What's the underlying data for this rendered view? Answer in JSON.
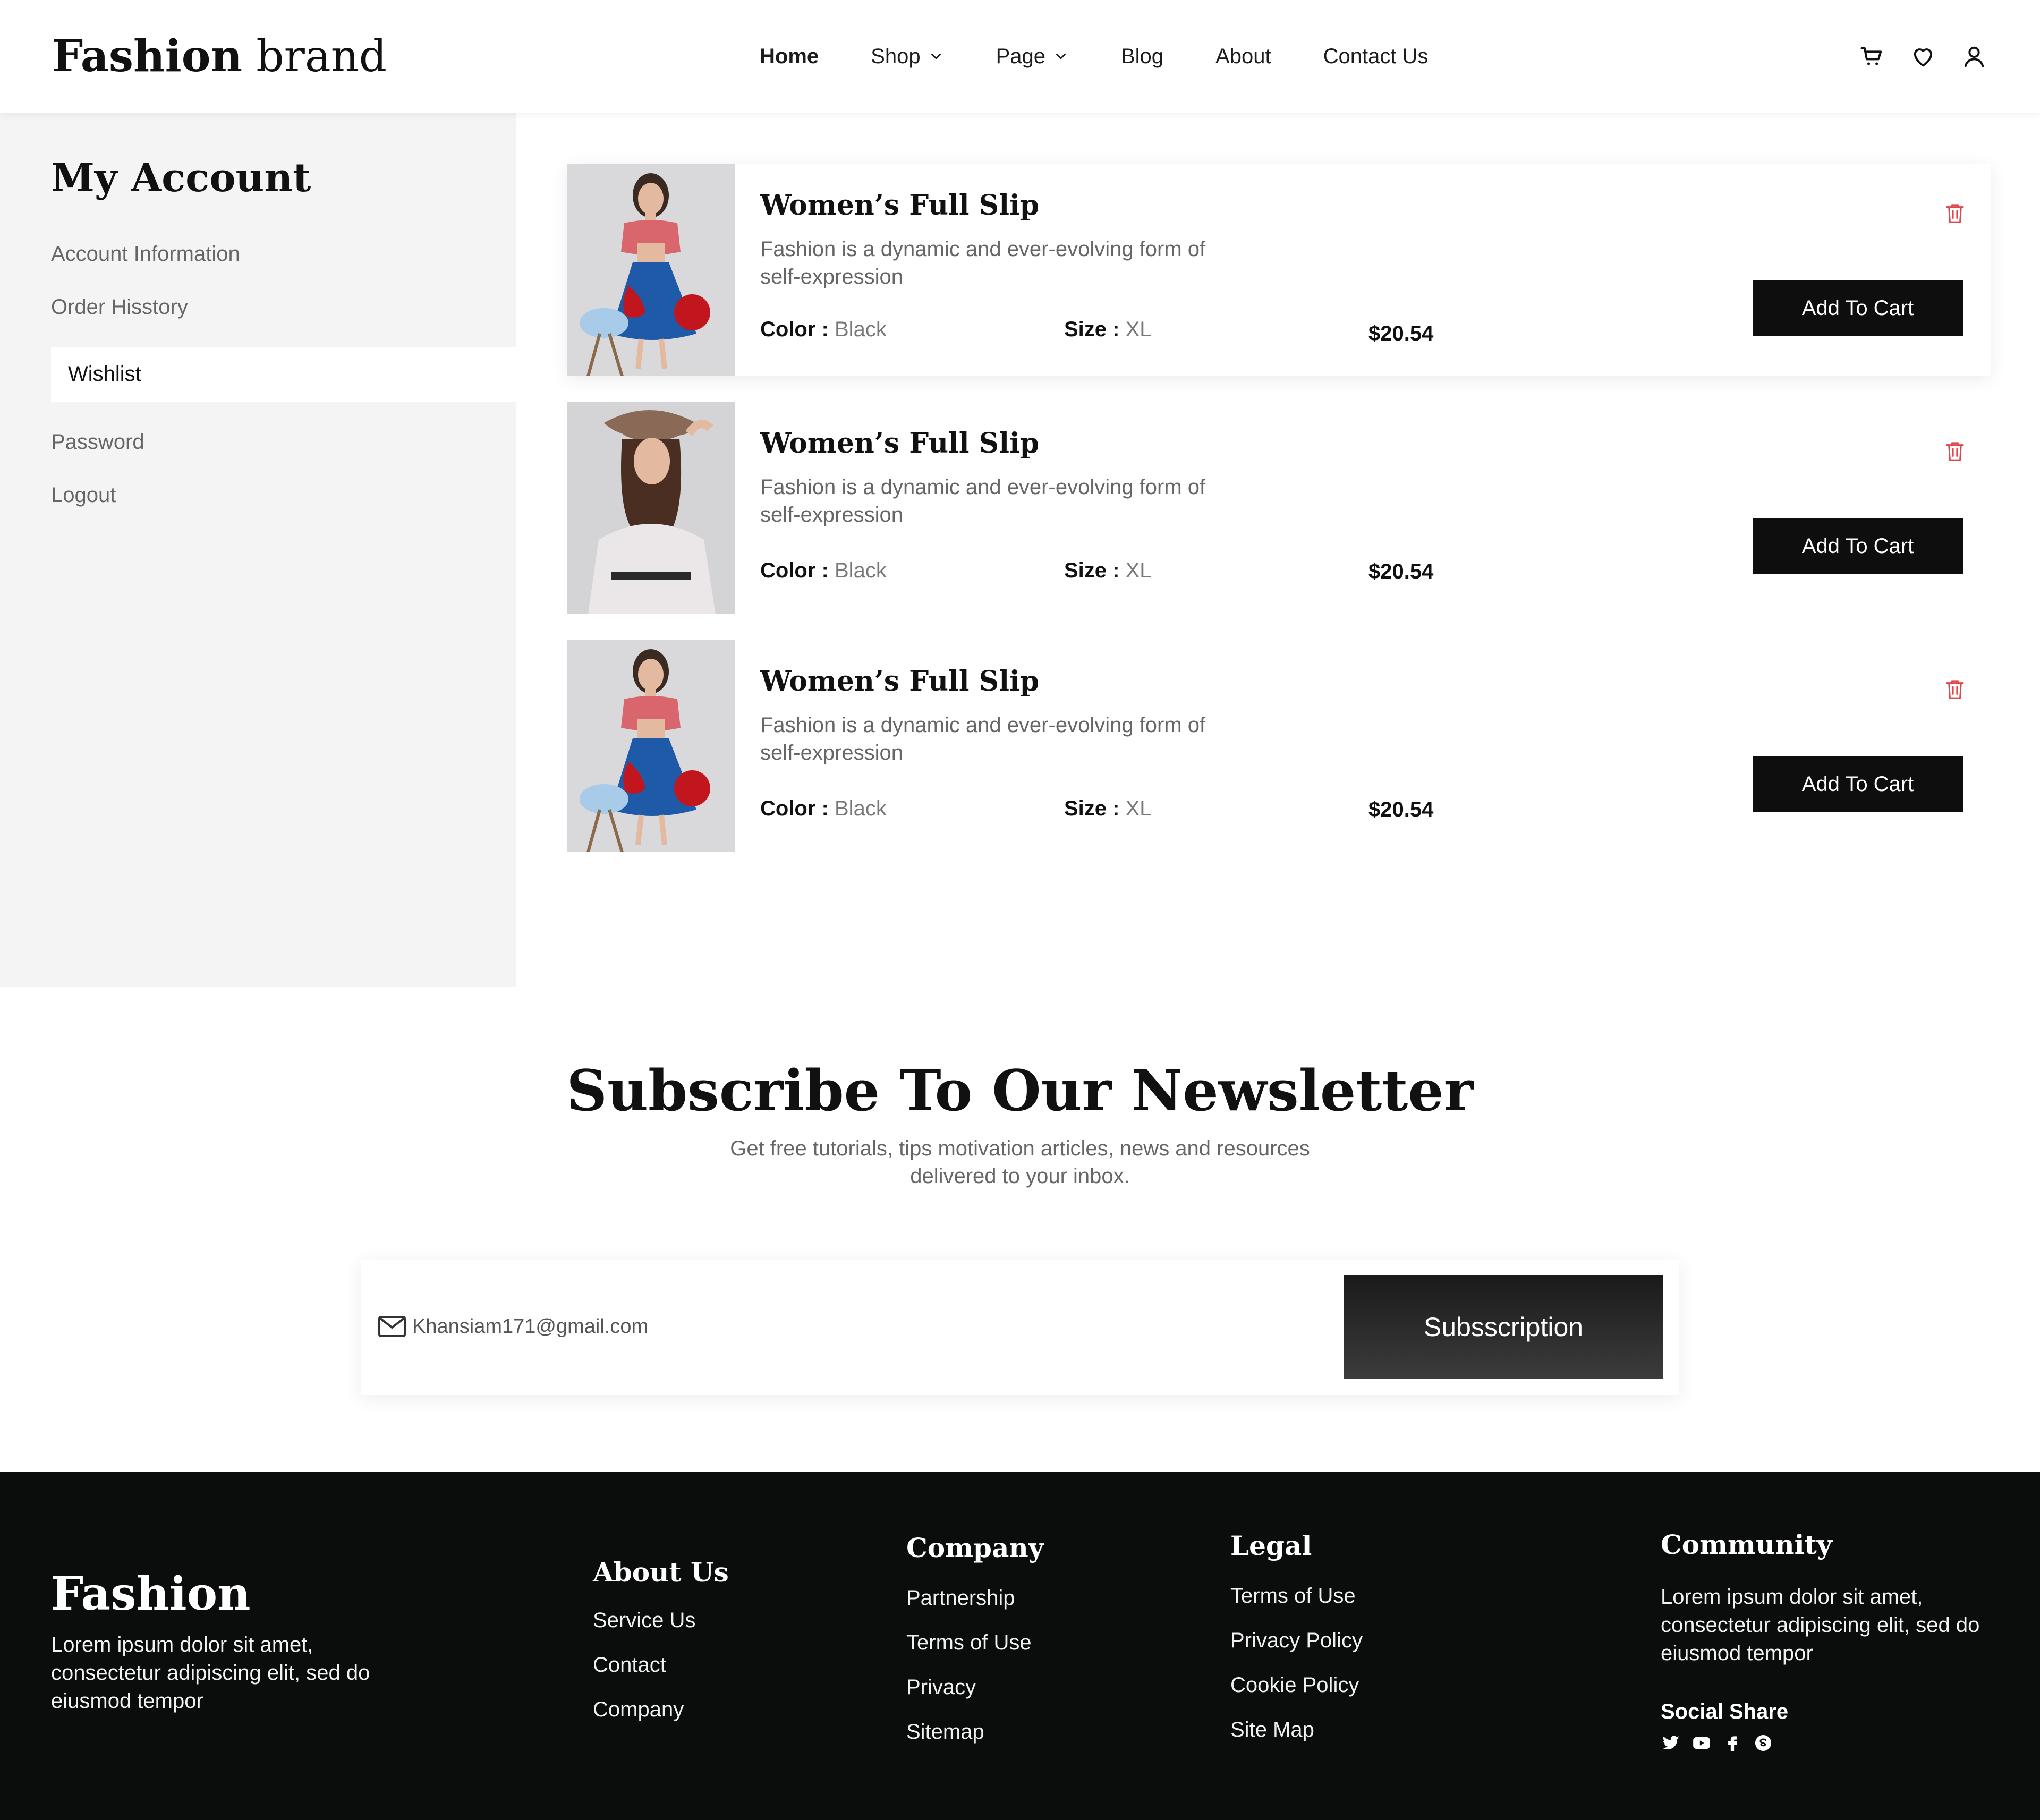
{
  "header": {
    "logo_bold": "Fashion",
    "logo_light": "brand",
    "nav": [
      {
        "label": "Home"
      },
      {
        "label": "Shop"
      },
      {
        "label": "Page"
      },
      {
        "label": "Blog"
      },
      {
        "label": "About"
      },
      {
        "label": "Contact Us"
      }
    ],
    "icons": [
      "cart-icon",
      "heart-icon",
      "user-icon"
    ]
  },
  "sidebar": {
    "title": "My Account",
    "items": [
      {
        "label": "Account Information"
      },
      {
        "label": "Order Hisstory"
      },
      {
        "label": "Wishlist",
        "active": true
      },
      {
        "label": "Password"
      },
      {
        "label": "Logout"
      }
    ]
  },
  "wishlist": {
    "items": [
      {
        "title": "Women’s Full Slip",
        "description": "Fashion is a dynamic and ever-evolving form of self-expression",
        "color_label": "Color :",
        "color": "Black",
        "size_label": "Size :",
        "size": "XL",
        "price": "$20.54",
        "button": "Add To Cart"
      },
      {
        "title": "Women’s Full Slip",
        "description": "Fashion is a dynamic and ever-evolving form of self-expression",
        "color_label": "Color :",
        "color": "Black",
        "size_label": "Size :",
        "size": "XL",
        "price": "$20.54",
        "button": "Add To Cart"
      },
      {
        "title": "Women’s Full Slip",
        "description": "Fashion is a dynamic and ever-evolving form of self-expression",
        "color_label": "Color :",
        "color": "Black",
        "size_label": "Size :",
        "size": "XL",
        "price": "$20.54",
        "button": "Add To Cart"
      }
    ]
  },
  "newsletter": {
    "title": "Subscribe To Our Newsletter",
    "subtitle": "Get free tutorials, tips motivation articles, news and resources delivered to your inbox.",
    "email_value": "Khansiam171@gmail.com",
    "button": "Subsscription"
  },
  "footer": {
    "brand": "Fashion",
    "brand_desc": "Lorem ipsum dolor sit amet, consectetur adipiscing elit, sed do eiusmod tempor",
    "about": {
      "title": "About Us",
      "links": [
        "Service Us",
        "Contact",
        "Company"
      ]
    },
    "company": {
      "title": "Company",
      "links": [
        "Partnership",
        "Terms of Use",
        "Privacy",
        "Sitemap"
      ]
    },
    "legal": {
      "title": "Legal",
      "links": [
        "Terms of Use",
        "Privacy Policy",
        "Cookie Policy",
        "Site Map"
      ]
    },
    "community": {
      "title": "Community",
      "desc": "Lorem ipsum dolor sit amet, consectetur adipiscing elit, sed do eiusmod tempor",
      "social_title": "Social Share"
    },
    "socials": [
      "twitter-icon",
      "youtube-icon",
      "facebook-icon",
      "skype-icon"
    ]
  },
  "colors": {
    "accent_dark": "#0e0e0e",
    "trash_red": "#e0474c",
    "sidebar_bg": "#f4f4f4",
    "footer_bg": "#0b0c0c"
  }
}
